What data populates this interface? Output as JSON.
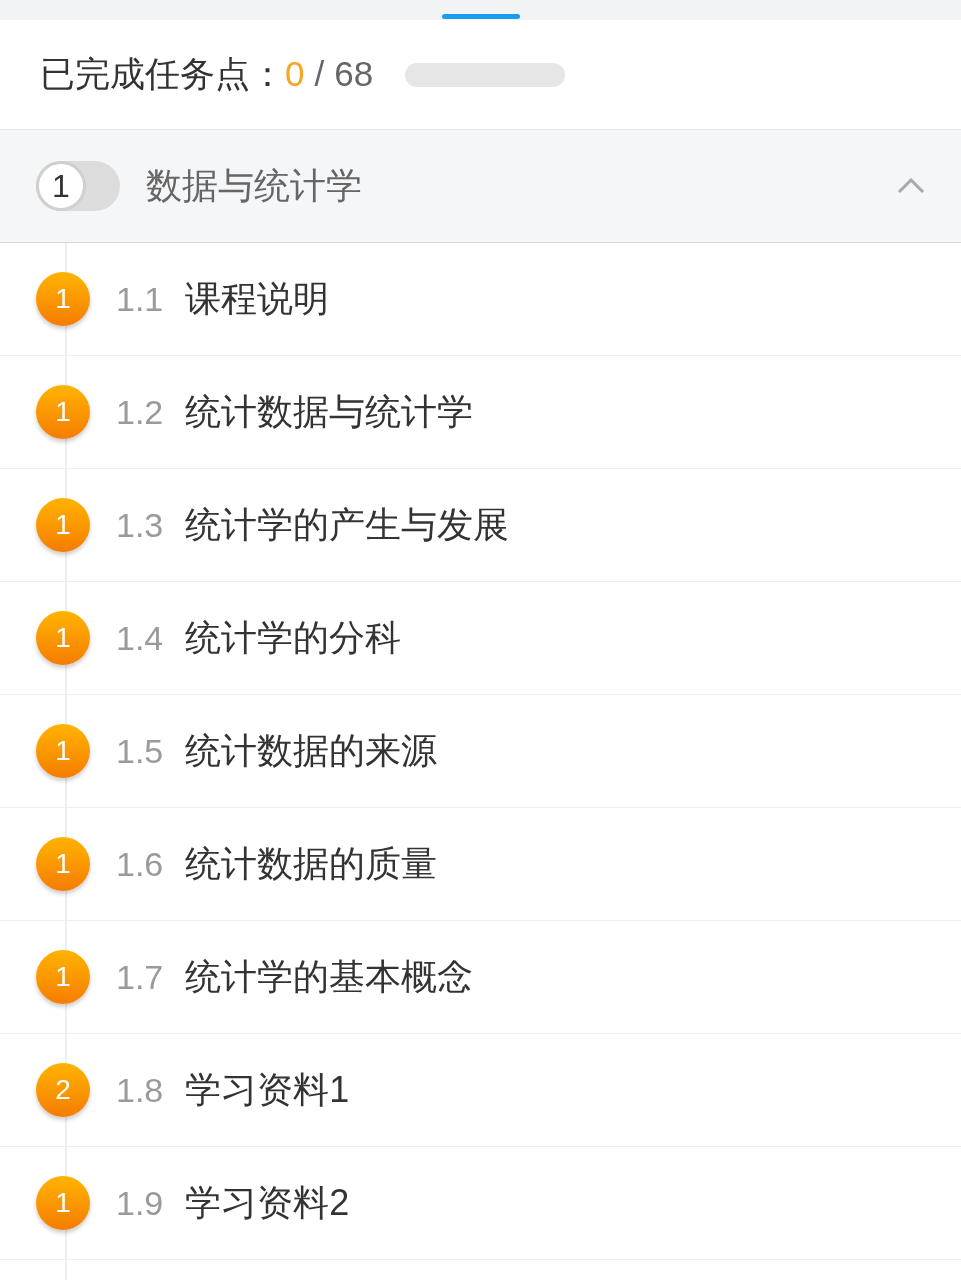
{
  "progress": {
    "label": "已完成任务点：",
    "done": "0",
    "separator": "/",
    "total": "68",
    "level": 0
  },
  "chapter": {
    "number": "1",
    "title": "数据与统计学",
    "expanded": true
  },
  "sections": [
    {
      "badge": "1",
      "number": "1.1",
      "title": "课程说明"
    },
    {
      "badge": "1",
      "number": "1.2",
      "title": "统计数据与统计学"
    },
    {
      "badge": "1",
      "number": "1.3",
      "title": "统计学的产生与发展"
    },
    {
      "badge": "1",
      "number": "1.4",
      "title": "统计学的分科"
    },
    {
      "badge": "1",
      "number": "1.5",
      "title": "统计数据的来源"
    },
    {
      "badge": "1",
      "number": "1.6",
      "title": "统计数据的质量"
    },
    {
      "badge": "1",
      "number": "1.7",
      "title": "统计学的基本概念"
    },
    {
      "badge": "2",
      "number": "1.8",
      "title": "学习资料1"
    },
    {
      "badge": "1",
      "number": "1.9",
      "title": "学习资料2"
    }
  ]
}
